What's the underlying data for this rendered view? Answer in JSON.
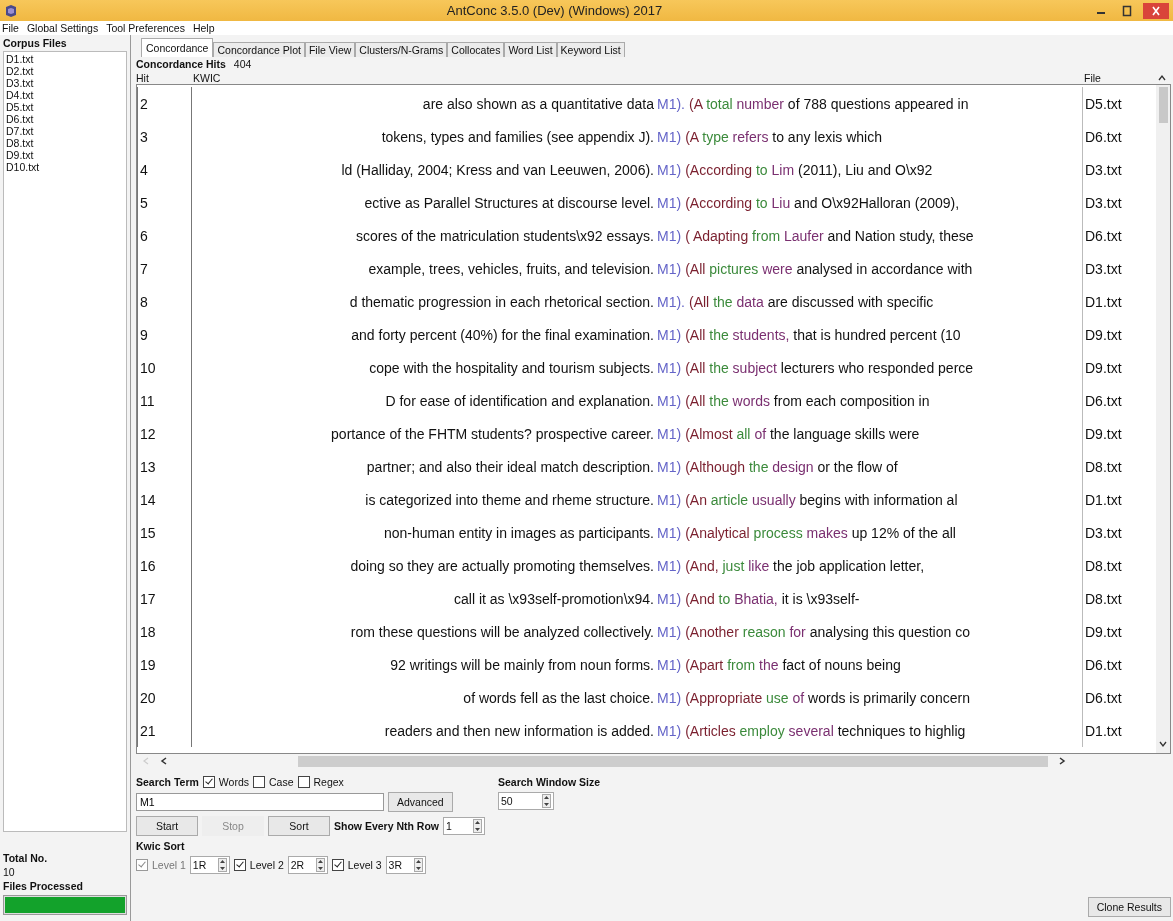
{
  "window": {
    "title": "AntConc 3.5.0 (Dev) (Windows) 2017"
  },
  "menu": [
    "File",
    "Global Settings",
    "Tool Preferences",
    "Help"
  ],
  "corpus_files": {
    "title": "Corpus Files",
    "files": [
      "D1.txt",
      "D2.txt",
      "D3.txt",
      "D4.txt",
      "D5.txt",
      "D6.txt",
      "D7.txt",
      "D8.txt",
      "D9.txt",
      "D10.txt"
    ]
  },
  "totals": {
    "total_label": "Total No.",
    "total_value": "10",
    "processed_label": "Files Processed",
    "progress": {
      "level": 1
    }
  },
  "tabs": [
    {
      "label": "Concordance",
      "selected": true
    },
    {
      "label": "Concordance Plot",
      "selected": false
    },
    {
      "label": "File View",
      "selected": false
    },
    {
      "label": "Clusters/N-Grams",
      "selected": false
    },
    {
      "label": "Collocates",
      "selected": false
    },
    {
      "label": "Word List",
      "selected": false
    },
    {
      "label": "Keyword List",
      "selected": false
    }
  ],
  "hits": {
    "label": "Concordance Hits",
    "value": "404"
  },
  "table": {
    "columns": [
      "Hit",
      "KWIC",
      "File"
    ],
    "rows": [
      {
        "hit": "2",
        "left": "are also shown as a quantitative data",
        "keyword": "M1).",
        "right": [
          "(A",
          "total",
          "number",
          "of 788 questions appeared in"
        ],
        "file": "D5.txt"
      },
      {
        "hit": "3",
        "left": "tokens, types and families (see appendix J).",
        "keyword": "M1)",
        "right": [
          "(A",
          "type",
          "refers",
          "to any lexis which"
        ],
        "file": "D6.txt"
      },
      {
        "hit": "4",
        "left": "ld (Halliday, 2004; Kress and van Leeuwen, 2006).",
        "keyword": "M1)",
        "right": [
          "(According",
          "to",
          "Lim",
          "(2011), Liu and O\\x92"
        ],
        "file": "D3.txt"
      },
      {
        "hit": "5",
        "left": "ective as Parallel Structures at discourse level.",
        "keyword": "M1)",
        "right": [
          "(According",
          "to",
          "Liu",
          "and O\\x92Halloran (2009),"
        ],
        "file": "D3.txt"
      },
      {
        "hit": "6",
        "left": "scores of the matriculation students\\x92 essays.",
        "keyword": "M1)",
        "right": [
          "( Adapting",
          "from",
          "Laufer",
          "and Nation study, these"
        ],
        "file": "D6.txt"
      },
      {
        "hit": "7",
        "left": "example, trees, vehicles, fruits, and television.",
        "keyword": "M1)",
        "right": [
          "(All",
          "pictures",
          "were",
          "analysed in accordance with"
        ],
        "file": "D3.txt"
      },
      {
        "hit": "8",
        "left": "d thematic progression in each rhetorical section.",
        "keyword": "M1).",
        "right": [
          "(All",
          "the",
          "data",
          "are discussed with specific"
        ],
        "file": "D1.txt"
      },
      {
        "hit": "9",
        "left": "and forty percent (40%) for the final examination.",
        "keyword": "M1)",
        "right": [
          "(All",
          "the",
          "students,",
          "that is hundred percent (10"
        ],
        "file": "D9.txt"
      },
      {
        "hit": "10",
        "left": "cope with the hospitality and tourism subjects.",
        "keyword": "M1)",
        "right": [
          "(All",
          "the",
          "subject",
          "lecturers who responded perce"
        ],
        "file": "D9.txt"
      },
      {
        "hit": "11",
        "left": "D for ease of identification and explanation.",
        "keyword": "M1)",
        "right": [
          "(All",
          "the",
          "words",
          "from each composition in"
        ],
        "file": "D6.txt"
      },
      {
        "hit": "12",
        "left": "portance of the FHTM students? prospective career.",
        "keyword": "M1)",
        "right": [
          "(Almost",
          "all",
          "of",
          "the language skills were"
        ],
        "file": "D9.txt"
      },
      {
        "hit": "13",
        "left": "partner; and also their ideal match description.",
        "keyword": "M1)",
        "right": [
          "(Although",
          "the",
          "design",
          "or the flow of"
        ],
        "file": "D8.txt"
      },
      {
        "hit": "14",
        "left": "is categorized into theme and rheme structure.",
        "keyword": "M1)",
        "right": [
          "(An",
          "article",
          "usually",
          "begins with information al"
        ],
        "file": "D1.txt"
      },
      {
        "hit": "15",
        "left": "non-human entity in images as participants.",
        "keyword": "M1)",
        "right": [
          "(Analytical",
          "process",
          "makes",
          "up 12% of the all"
        ],
        "file": "D3.txt"
      },
      {
        "hit": "16",
        "left": "doing so they are actually promoting themselves.",
        "keyword": "M1)",
        "right": [
          "(And,",
          "just",
          "like",
          "the job application letter,"
        ],
        "file": "D8.txt"
      },
      {
        "hit": "17",
        "left": "call it as \\x93self-promotion\\x94.",
        "keyword": "M1)",
        "right": [
          "(And",
          "to",
          "Bhatia,",
          "it is \\x93self-"
        ],
        "file": "D8.txt"
      },
      {
        "hit": "18",
        "left": "rom these questions will be analyzed collectively.",
        "keyword": "M1)",
        "right": [
          "(Another",
          "reason",
          "for",
          "analysing this question co"
        ],
        "file": "D9.txt"
      },
      {
        "hit": "19",
        "left": "92 writings will be mainly from noun forms.",
        "keyword": "M1)",
        "right": [
          "(Apart",
          "from",
          "the",
          "fact of nouns being"
        ],
        "file": "D6.txt"
      },
      {
        "hit": "20",
        "left": "of words fell as the last choice.",
        "keyword": "M1)",
        "right": [
          "(Appropriate",
          "use",
          "of",
          "words is primarily concern"
        ],
        "file": "D6.txt"
      },
      {
        "hit": "21",
        "left": "readers and then new information is added.",
        "keyword": "M1)",
        "right": [
          "(Articles",
          "employ",
          "several",
          "techniques to highlig"
        ],
        "file": "D1.txt"
      }
    ]
  },
  "search": {
    "label": "Search Term",
    "options": [
      {
        "label": "Words",
        "checked": true
      },
      {
        "label": "Case",
        "checked": false
      },
      {
        "label": "Regex",
        "checked": false
      }
    ],
    "value": "M1",
    "advanced": "Advanced"
  },
  "buttons": [
    {
      "label": "Start",
      "disabled": false
    },
    {
      "label": "Stop",
      "disabled": true
    },
    {
      "label": "Sort",
      "disabled": false
    }
  ],
  "nth_row": {
    "label": "Show Every Nth Row",
    "value": "1"
  },
  "window_size": {
    "label": "Search Window Size",
    "value": "50"
  },
  "kwic_sort": {
    "label": "Kwic Sort",
    "levels": [
      {
        "label": "Level 1",
        "checked": true,
        "disabled": true,
        "value": "1R"
      },
      {
        "label": "Level 2",
        "checked": true,
        "disabled": false,
        "value": "2R"
      },
      {
        "label": "Level 3",
        "checked": true,
        "disabled": false,
        "value": "3R"
      }
    ]
  },
  "clone": "Clone Results"
}
